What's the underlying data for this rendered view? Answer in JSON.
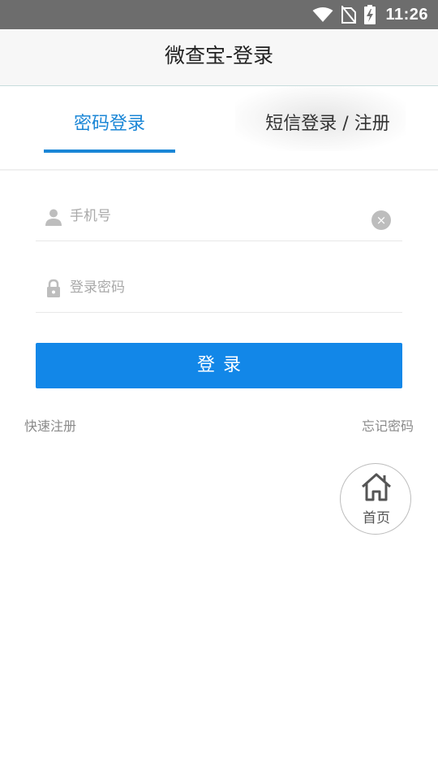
{
  "status_bar": {
    "time": "11:26",
    "icons": [
      "wifi-icon",
      "no-sim-icon",
      "battery-charging-icon"
    ]
  },
  "header": {
    "title": "微查宝-登录"
  },
  "tabs": [
    {
      "label": "密码登录",
      "active": true
    },
    {
      "label": "短信登录 / 注册",
      "active": false
    }
  ],
  "form": {
    "phone_placeholder": "手机号",
    "password_placeholder": "登录密码",
    "clear_symbol": "×",
    "login_label": "登录"
  },
  "links": {
    "register": "快速注册",
    "forgot": "忘记密码"
  },
  "home_button": {
    "label": "首页",
    "icon": "home-icon"
  },
  "colors": {
    "accent": "#1287e8",
    "tab_active": "#1a86d6",
    "status_bar": "#6d6d6d"
  }
}
